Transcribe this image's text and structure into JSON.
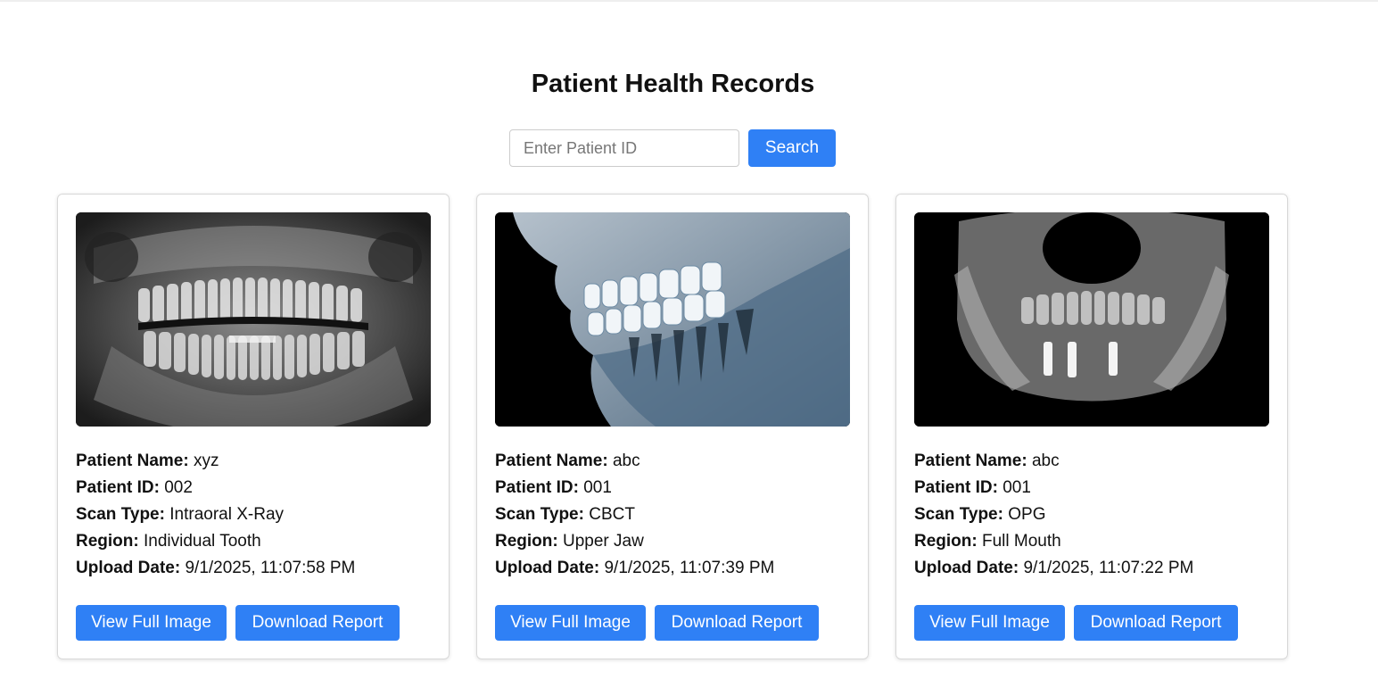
{
  "page": {
    "title": "Patient Health Records"
  },
  "search": {
    "placeholder": "Enter Patient ID",
    "value": "",
    "button_label": "Search"
  },
  "labels": {
    "patient_name": "Patient Name:",
    "patient_id": "Patient ID:",
    "scan_type": "Scan Type:",
    "region": "Region:",
    "upload_date": "Upload Date:"
  },
  "records": [
    {
      "patient_name": "xyz",
      "patient_id": "002",
      "scan_type": "Intraoral X-Ray",
      "region": "Individual Tooth",
      "upload_date": "9/1/2025, 11:07:58 PM",
      "image": "panoramic-xray-image",
      "view_label": "View Full Image",
      "download_label": "Download Report"
    },
    {
      "patient_name": "abc",
      "patient_id": "001",
      "scan_type": "CBCT",
      "region": "Upper Jaw",
      "upload_date": "9/1/2025, 11:07:39 PM",
      "image": "side-jaw-xray-image",
      "view_label": "View Full Image",
      "download_label": "Download Report"
    },
    {
      "patient_name": "abc",
      "patient_id": "001",
      "scan_type": "OPG",
      "region": "Full Mouth",
      "upload_date": "9/1/2025, 11:07:22 PM",
      "image": "frontal-skull-xray-image",
      "view_label": "View Full Image",
      "download_label": "Download Report"
    }
  ],
  "colors": {
    "accent": "#2f80f5",
    "card_border": "#d8d8d8"
  }
}
